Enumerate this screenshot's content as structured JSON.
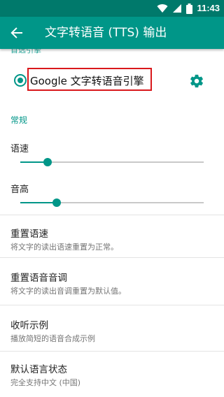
{
  "status_bar": {
    "time": "11:43",
    "icons": [
      "wifi-icon",
      "signal-icon",
      "battery-icon"
    ],
    "color": "#00796b"
  },
  "app_bar": {
    "title": "文字转语音 (TTS) 输出",
    "back_icon": "arrow-back-icon",
    "color": "#009688"
  },
  "engine_section": {
    "header": "首选引擎",
    "engine_name": "Google 文字转语音引擎",
    "selected": true,
    "settings_icon": "gear-icon"
  },
  "general": {
    "header": "常规",
    "speech_rate": {
      "label": "语速",
      "value_fraction": 0.15
    },
    "pitch": {
      "label": "音高",
      "value_fraction": 0.2
    }
  },
  "items": [
    {
      "title": "重置语速",
      "summary": "将文字的读出语速重置为正常。"
    },
    {
      "title": "重置语音音调",
      "summary": "将文字的读出音调重置为默认值。"
    },
    {
      "title": "收听示例",
      "summary": "播放简短的语音合成示例"
    },
    {
      "title": "默认语言状态",
      "summary": "完全支持中文 (中国)"
    }
  ],
  "colors": {
    "accent": "#009688",
    "highlight_border": "#d9181c"
  }
}
